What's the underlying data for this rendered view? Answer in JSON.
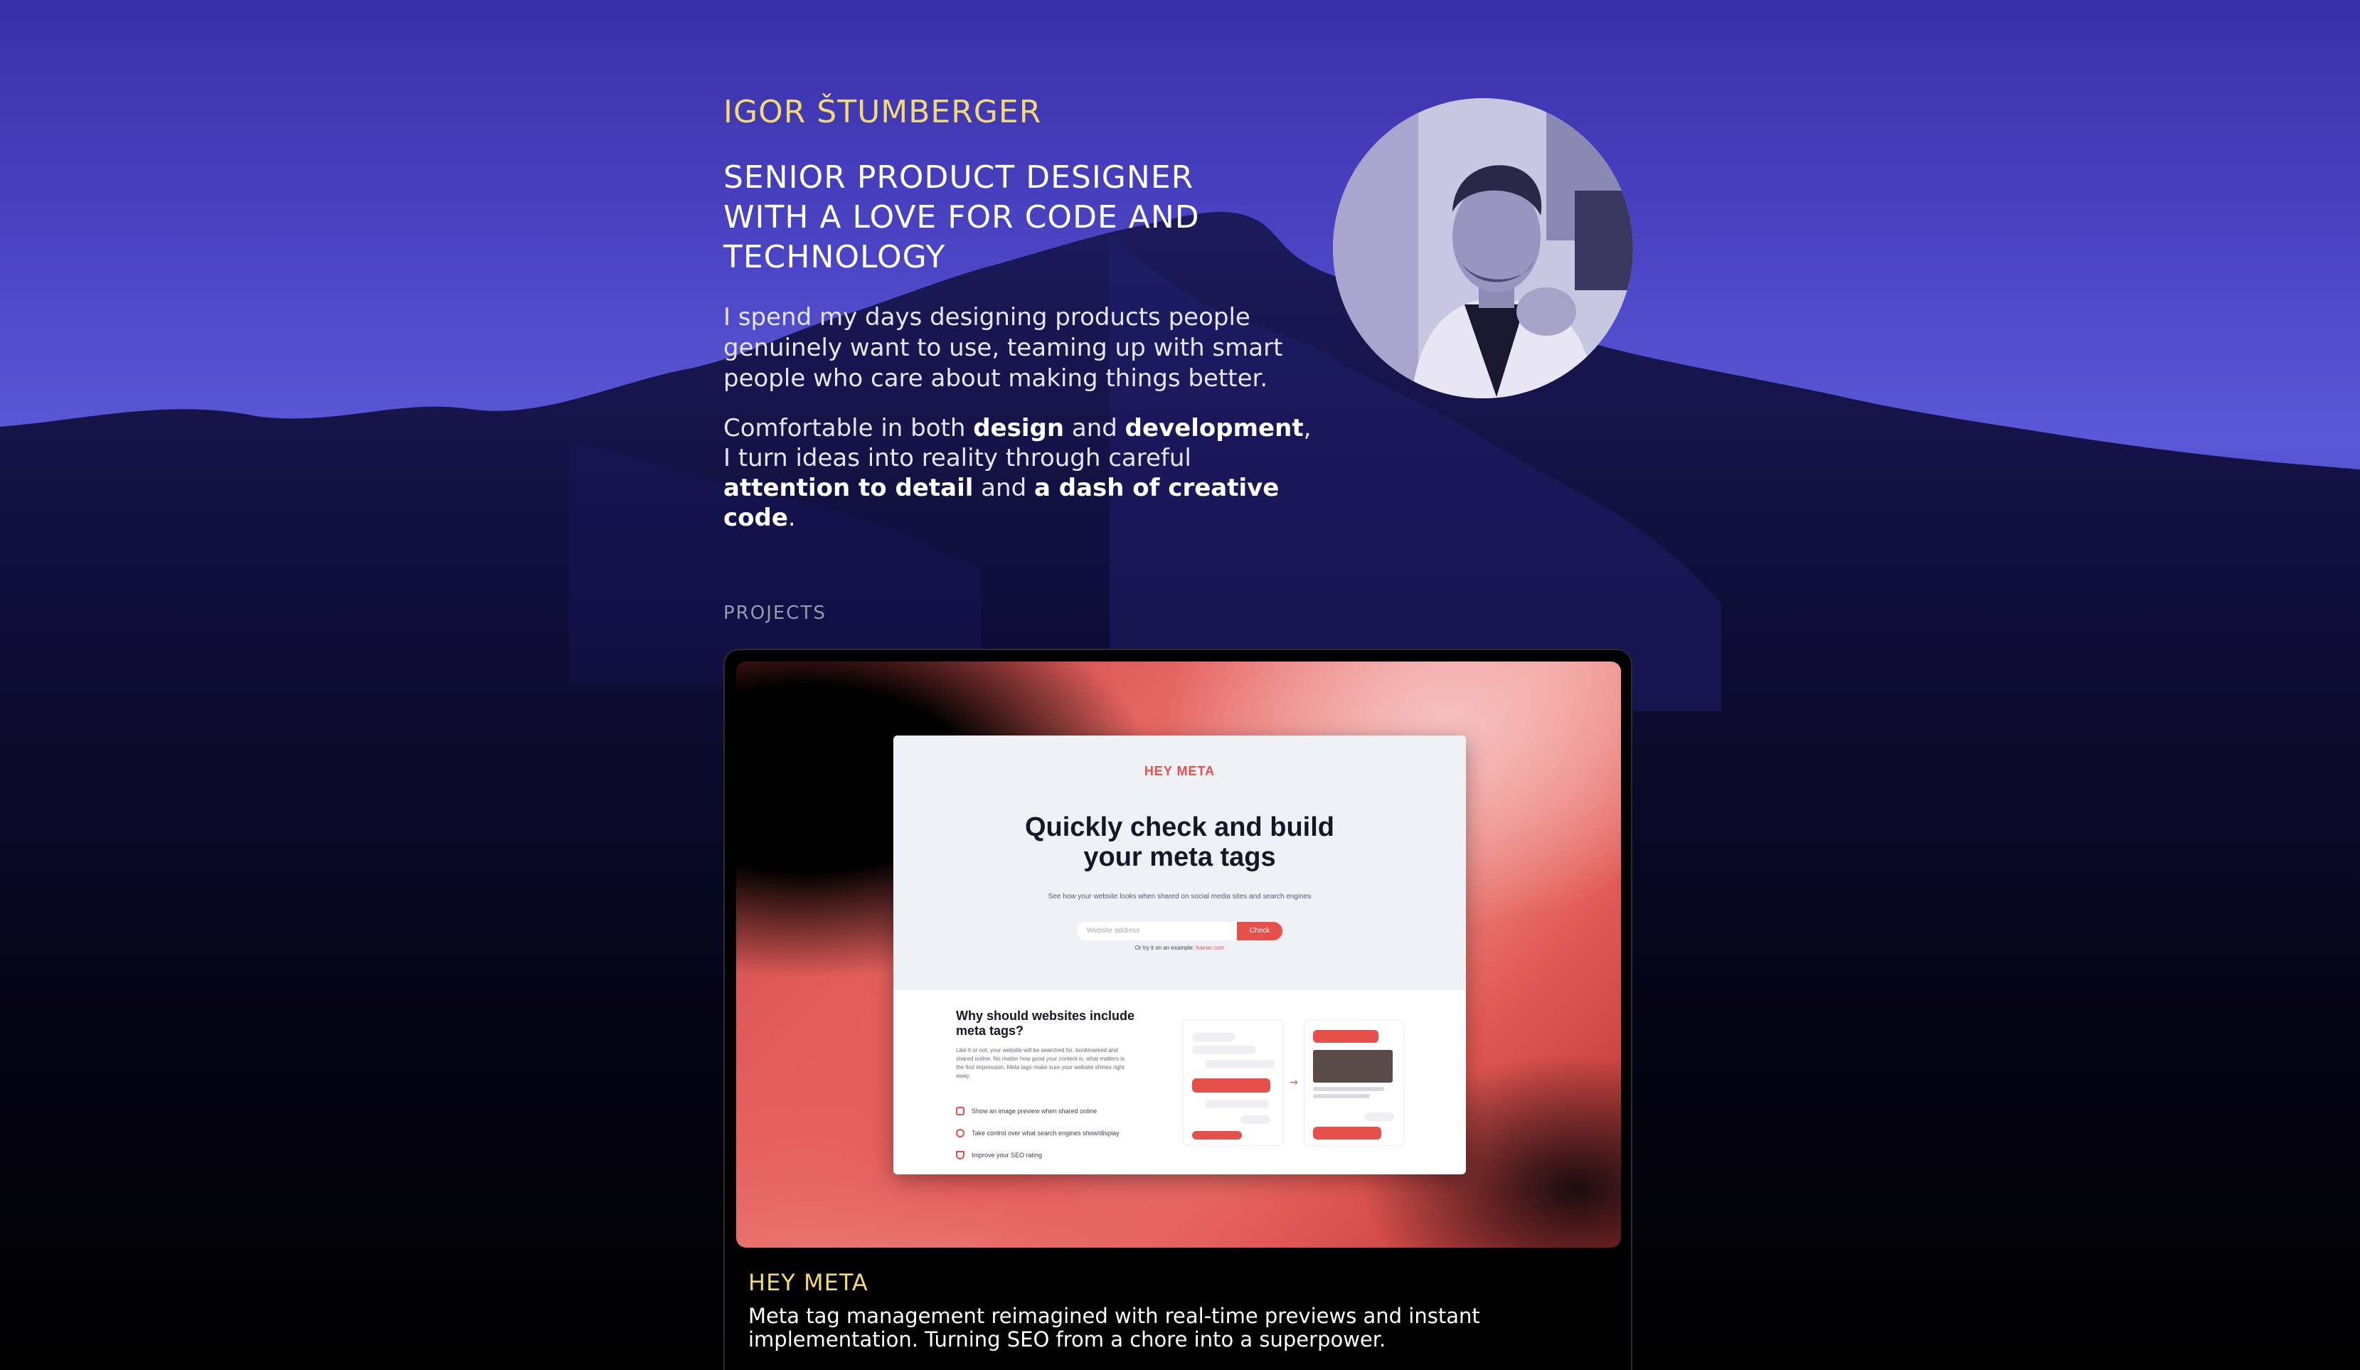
{
  "profile": {
    "name": "IGOR ŠTUMBERGER",
    "headline": "SENIOR PRODUCT DESIGNER WITH A LOVE FOR CODE AND TECHNOLOGY",
    "intro": "I spend my days designing products people genuinely want to use, teaming up with smart people who care about making things better.",
    "intro2": {
      "t1": "Comfortable in both ",
      "b1": "design",
      "t2": " and ",
      "b2": "development",
      "t3": ", I turn ideas into reality through careful ",
      "b3": "attention to detail",
      "t4": " and ",
      "b4": "a dash of creative code",
      "t5": "."
    },
    "avatar_icon": "profile-photo"
  },
  "projects": {
    "label": "PROJECTS",
    "items": [
      {
        "title": "HEY META",
        "description": "Meta tag management reimagined with real-time previews and instant implementation. Turning SEO from a chore into a superpower.",
        "preview": {
          "logo": "HEY META",
          "title_line1": "Quickly check and build",
          "title_line2": "your meta tags",
          "subtitle": "See how your website looks when shared on social media sites and search engines",
          "input_placeholder": "Website address",
          "check_label": "Check",
          "example_prefix": "Or try it on an example: ",
          "example_link": "framer.com",
          "why_title": "Why should websites include meta tags?",
          "why_text": "Like it or not, your website will be searched for, bookmarked and shared online. No matter how good your content is, what matters is the first impression. Meta tags make sure your website shines right away.",
          "features": [
            "Show an image preview when shared online",
            "Take control over what search engines show/display",
            "Improve your SEO rating"
          ]
        }
      }
    ]
  },
  "colors": {
    "accent_yellow": "#f2d974",
    "brand_red": "#e5504a"
  }
}
